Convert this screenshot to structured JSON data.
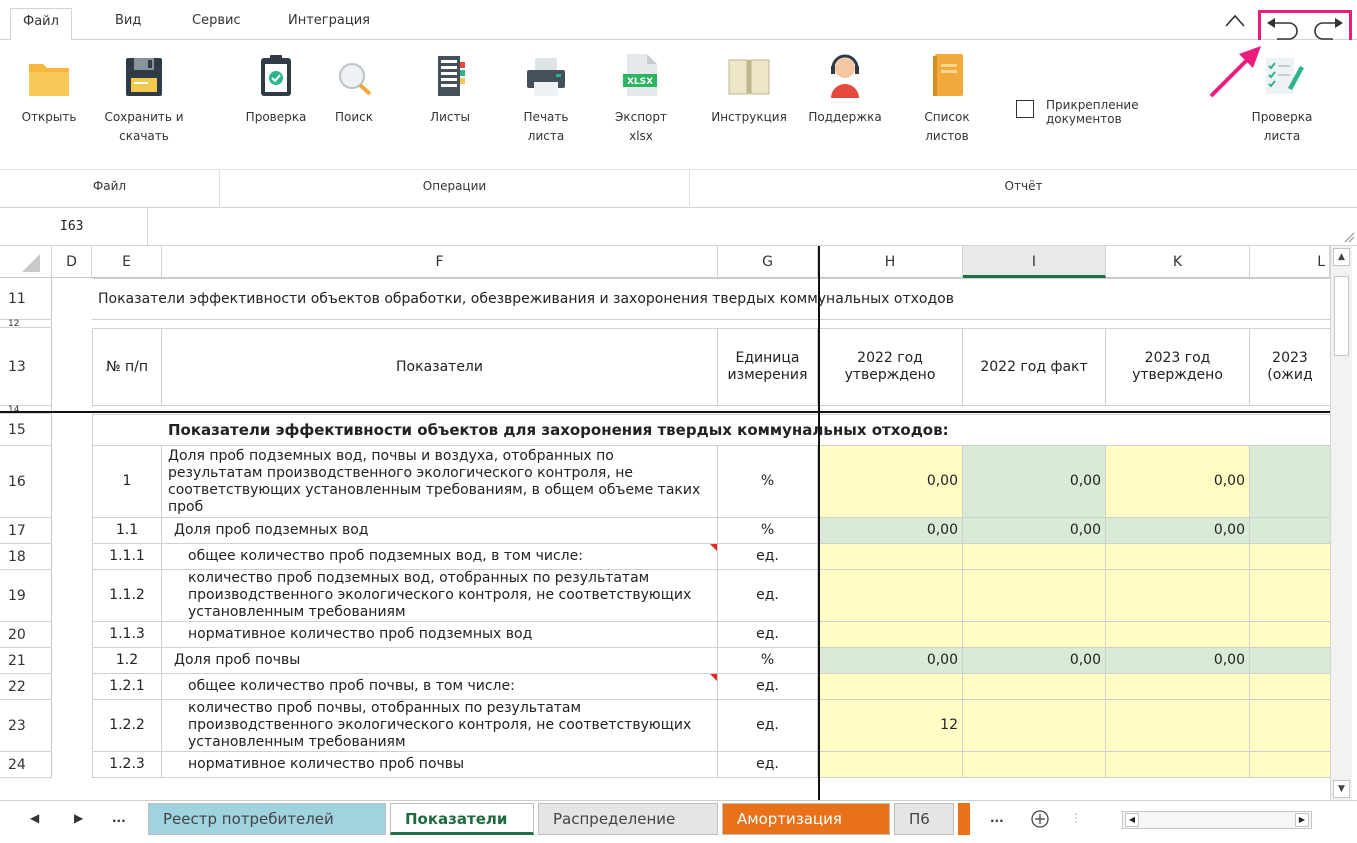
{
  "ribbon": {
    "tabs": [
      "Файл",
      "Вид",
      "Сервис",
      "Интеграция"
    ],
    "buttons": {
      "open": "Открыть",
      "save": "Сохранить и\nскачать",
      "check": "Проверка",
      "search": "Поиск",
      "sheets": "Листы",
      "print": "Печать\nлиста",
      "export": "Экспорт\nxlsx",
      "manual": "Инструкция",
      "support": "Поддержка",
      "sheetlist": "Список\nлистов",
      "checksheet": "Проверка\nлиста",
      "export_badge": "XLSX"
    },
    "attach_label": "Прикрепление документов",
    "groups": [
      "Файл",
      "Операции",
      "Отчёт"
    ]
  },
  "formula_bar": {
    "cell_ref": "I63"
  },
  "columns": [
    "D",
    "E",
    "F",
    "G",
    "H",
    "I",
    "K",
    "L"
  ],
  "rows": {
    "r11": {
      "num": "11",
      "text": "Показатели эффективности объектов обработки, обезвреживания и захоронения твердых коммунальных отходов"
    },
    "r12": {
      "num": "12"
    },
    "r13": {
      "num": "13",
      "no": "№ п/п",
      "name": "Показатели",
      "unit": "Единица измерения",
      "h": "2022 год утверждено",
      "i": "2022 год факт",
      "k": "2023 год утверждено",
      "l": "2023 (ожид"
    },
    "r14": {
      "num": "14"
    },
    "r15": {
      "num": "15",
      "text": "Показатели эффективности объектов для захоронения твердых коммунальных отходов:"
    },
    "r16": {
      "num": "16",
      "no": "1",
      "name": "Доля проб подземных вод, почвы и воздуха, отобранных по результатам производственного экологического контроля, не соответствующих установленным требованиям, в общем объеме таких проб",
      "unit": "%",
      "h": "0,00",
      "i": "0,00",
      "k": "0,00"
    },
    "r17": {
      "num": "17",
      "no": "1.1",
      "name": "Доля проб подземных вод",
      "unit": "%",
      "h": "0,00",
      "i": "0,00",
      "k": "0,00"
    },
    "r18": {
      "num": "18",
      "no": "1.1.1",
      "name": "общее количество проб подземных вод, в том числе:",
      "unit": "ед."
    },
    "r19": {
      "num": "19",
      "no": "1.1.2",
      "name": "количество проб подземных вод, отобранных по результатам производственного экологического контроля, не соответствующих установленным требованиям",
      "unit": "ед."
    },
    "r20": {
      "num": "20",
      "no": "1.1.3",
      "name": "нормативное количество проб подземных вод",
      "unit": "ед."
    },
    "r21": {
      "num": "21",
      "no": "1.2",
      "name": "Доля проб почвы",
      "unit": "%",
      "h": "0,00",
      "i": "0,00",
      "k": "0,00"
    },
    "r22": {
      "num": "22",
      "no": "1.2.1",
      "name": "общее количество проб почвы, в том числе:",
      "unit": "ед."
    },
    "r23": {
      "num": "23",
      "no": "1.2.2",
      "name": "количество проб почвы, отобранных по результатам производственного экологического контроля, не соответствующих установленным требованиям",
      "unit": "ед.",
      "h": "12"
    },
    "r24": {
      "num": "24",
      "no": "1.2.3",
      "name": "нормативное количество проб почвы",
      "unit": "ед."
    }
  },
  "sheet_tabs": {
    "nav_more": "...",
    "tabs": [
      "Реестр потребителей",
      "Показатели",
      "Распределение",
      "Амортизация",
      "П6"
    ],
    "more": "..."
  },
  "colors": {
    "accent": "#1e7145",
    "highlight": "#ec1b7c",
    "yellow_cell": "#fffdc4",
    "green_cell": "#d9ead7"
  }
}
